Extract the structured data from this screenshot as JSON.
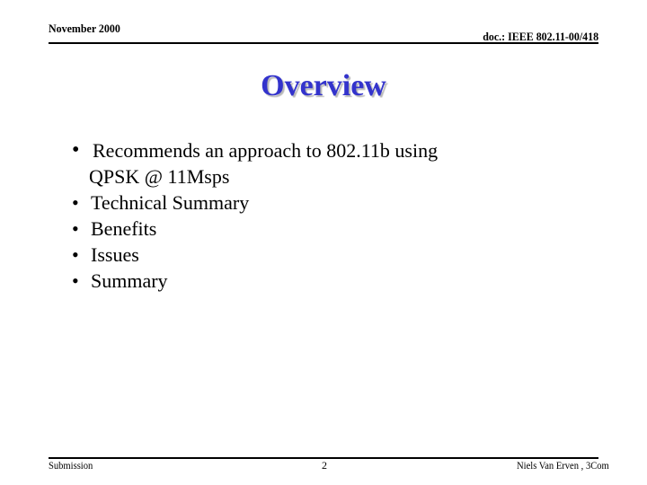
{
  "header": {
    "date": "November 2000",
    "doc_id": "doc.: IEEE 802.11-00/418"
  },
  "slide": {
    "title": "Overview",
    "bullets": [
      {
        "line1": "Recommends an approach to 802.11b using",
        "line2": "QPSK @ 11Msps"
      },
      {
        "line1": "Technical Summary"
      },
      {
        "line1": "Benefits"
      },
      {
        "line1": "Issues"
      },
      {
        "line1": "Summary"
      }
    ],
    "bullet_glyph": "•",
    "title_color": "#3333cc"
  },
  "footer": {
    "left": "Submission",
    "page_number": "2",
    "author": "Niels Van Erven , 3Com"
  }
}
